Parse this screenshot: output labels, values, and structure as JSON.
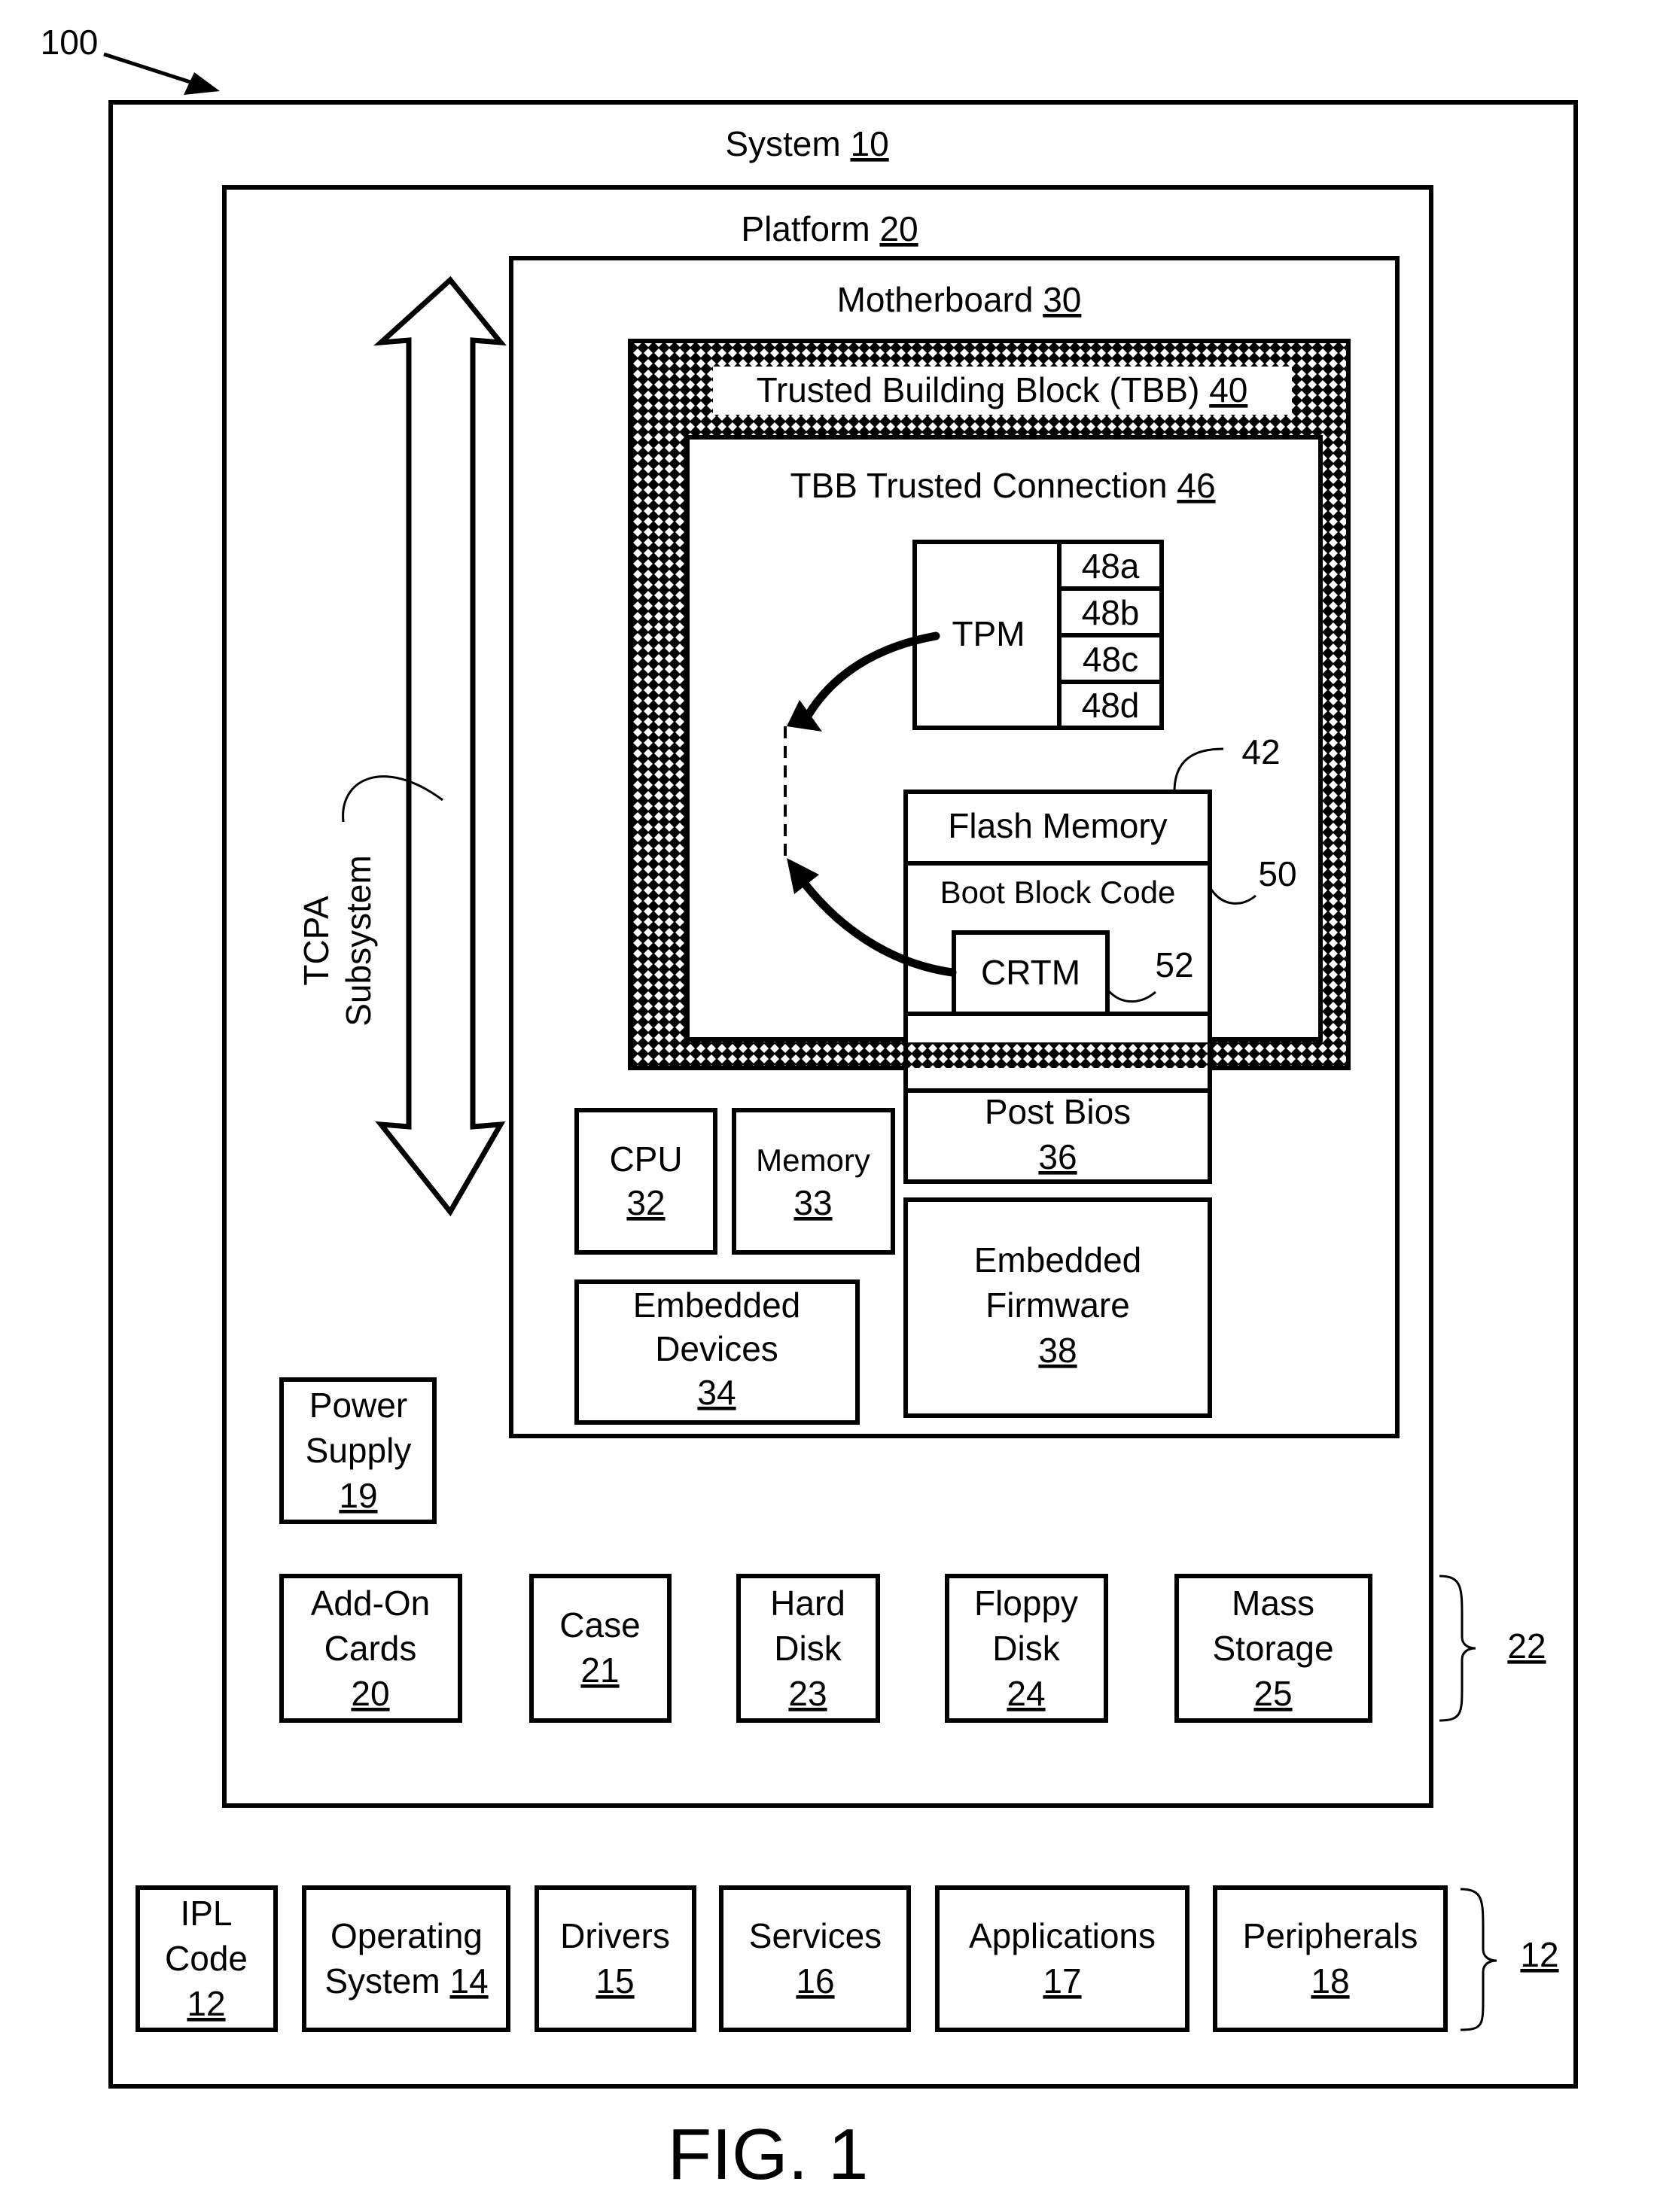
{
  "figure": {
    "label": "FIG. 1",
    "ref_number": "100"
  },
  "system": {
    "name": "System",
    "ref": "10"
  },
  "platform": {
    "name": "Platform",
    "ref": "20"
  },
  "motherboard": {
    "name": "Motherboard",
    "ref": "30"
  },
  "tbb": {
    "name": "Trusted Building Block (TBB)",
    "ref": "40"
  },
  "tbb_connection": {
    "name": "TBB Trusted Connection",
    "ref": "46"
  },
  "tpm": {
    "label": "TPM",
    "registers": [
      "48a",
      "48b",
      "48c",
      "48d"
    ]
  },
  "flash": {
    "name": "Flash Memory",
    "ref": "42",
    "boot_block": {
      "name": "Boot Block Code",
      "ref": "50"
    },
    "crtm": {
      "name": "CRTM",
      "ref": "52"
    },
    "post_bios": {
      "name": "Post Bios",
      "ref": "36"
    }
  },
  "tcpa": {
    "line1": "TCPA",
    "line2": "Subsystem"
  },
  "motherboard_components": {
    "cpu": {
      "name": "CPU",
      "ref": "32"
    },
    "memory": {
      "name": "Memory",
      "ref": "33"
    },
    "embedded_devices": {
      "line1": "Embedded",
      "line2": "Devices",
      "ref": "34"
    },
    "embedded_firmware": {
      "line1": "Embedded",
      "line2": "Firmware",
      "ref": "38"
    }
  },
  "power_supply": {
    "line1": "Power",
    "line2": "Supply",
    "ref": "19"
  },
  "platform_components": {
    "group_ref": "22",
    "items": [
      {
        "line1": "Add-On",
        "line2": "Cards",
        "ref": "20"
      },
      {
        "line1": "Case",
        "line2": "",
        "ref": "21"
      },
      {
        "line1": "Hard",
        "line2": "Disk",
        "ref": "23"
      },
      {
        "line1": "Floppy",
        "line2": "Disk",
        "ref": "24"
      },
      {
        "line1": "Mass",
        "line2": "Storage",
        "ref": "25"
      }
    ]
  },
  "software_components": {
    "group_ref": "12",
    "items": [
      {
        "line1": "IPL",
        "line2": "Code",
        "ref": "12"
      },
      {
        "line1": "Operating",
        "line2": "System",
        "ref": "14"
      },
      {
        "line1": "Drivers",
        "line2": "",
        "ref": "15"
      },
      {
        "line1": "Services",
        "line2": "",
        "ref": "16"
      },
      {
        "line1": "Applications",
        "line2": "",
        "ref": "17"
      },
      {
        "line1": "Peripherals",
        "line2": "",
        "ref": "18"
      }
    ]
  }
}
